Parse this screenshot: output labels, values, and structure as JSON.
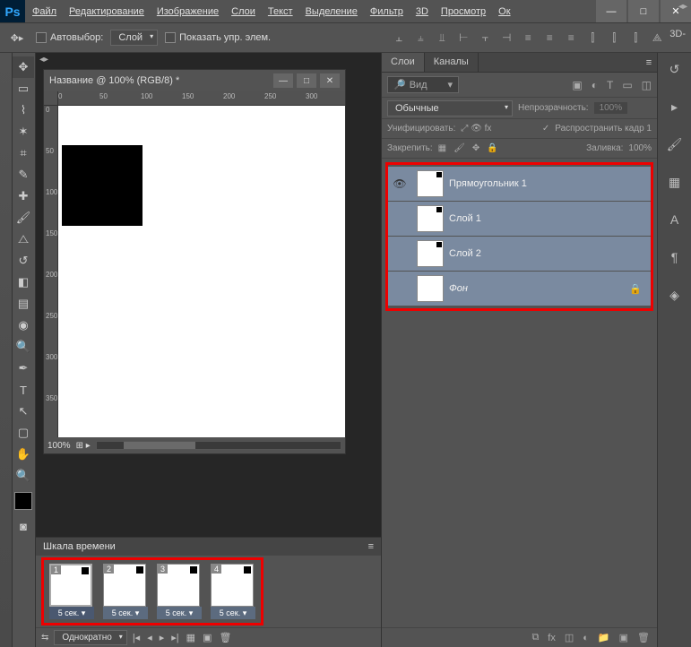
{
  "app": {
    "logo": "Ps"
  },
  "menu": [
    "Файл",
    "Редактирование",
    "Изображение",
    "Слои",
    "Текст",
    "Выделение",
    "Фильтр",
    "3D",
    "Просмотр",
    "Ок"
  ],
  "options": {
    "autoselect": "Автовыбор:",
    "autoselect_mode": "Слой",
    "show_controls": "Показать упр. элем.",
    "threeD": "3D-"
  },
  "doc": {
    "title": "Название @ 100% (RGB/8) *",
    "ruler_h": [
      "0",
      "50",
      "100",
      "150",
      "200",
      "250",
      "300"
    ],
    "ruler_v": [
      "0",
      "50",
      "100",
      "150",
      "200",
      "250",
      "300",
      "350"
    ],
    "zoom": "100%"
  },
  "panel": {
    "tabs": [
      "Слои",
      "Каналы"
    ],
    "search_placeholder": "Вид",
    "blend_mode": "Обычные",
    "opacity_label": "Непрозрачность:",
    "opacity_value": "100%",
    "unify_label": "Унифицировать:",
    "propagate": "Распространить кадр 1",
    "lock_label": "Закрепить:",
    "fill_label": "Заливка:",
    "fill_value": "100%"
  },
  "layers": [
    {
      "visible": true,
      "name": "Прямоугольник 1",
      "locked": false
    },
    {
      "visible": false,
      "name": "Слой 1",
      "locked": false
    },
    {
      "visible": false,
      "name": "Слой 2",
      "locked": false
    },
    {
      "visible": false,
      "name": "Фон",
      "locked": true,
      "italic": true
    }
  ],
  "timeline": {
    "title": "Шкала времени",
    "loop": "Однократно",
    "frames": [
      {
        "num": "1",
        "dur": "5 сек. ▾",
        "active": true
      },
      {
        "num": "2",
        "dur": "5 сек. ▾",
        "active": false
      },
      {
        "num": "3",
        "dur": "5 сек. ▾",
        "active": false
      },
      {
        "num": "4",
        "dur": "5 сек. ▾",
        "active": false
      }
    ]
  }
}
